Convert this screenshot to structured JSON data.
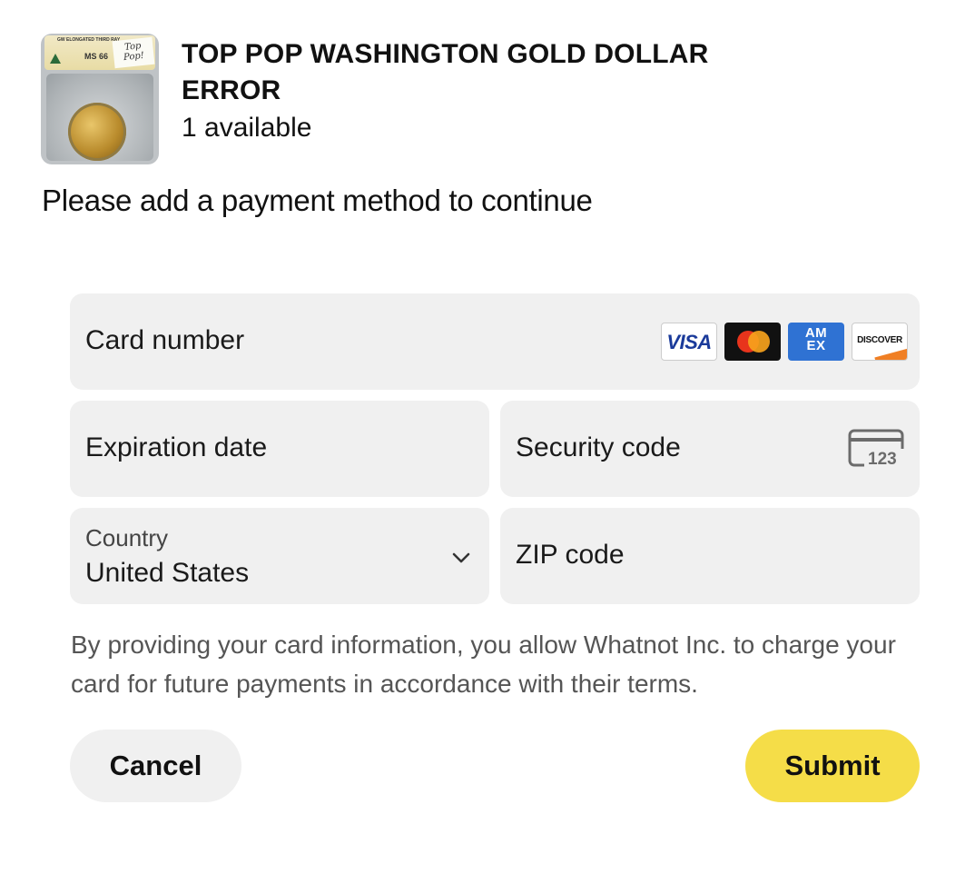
{
  "product": {
    "title": "TOP POP WASHINGTON GOLD DOLLAR ERROR",
    "availability": "1 available",
    "thumbnail": {
      "slab_description": "GW  ELONGATED THIRD RAY",
      "grade": "MS 66",
      "note": "Top Pop!"
    }
  },
  "prompt": "Please add a payment method to continue",
  "form": {
    "card_number_label": "Card number",
    "card_brands": [
      {
        "name": "visa-icon",
        "label": "VISA"
      },
      {
        "name": "mastercard-icon",
        "label": ""
      },
      {
        "name": "amex-icon",
        "label": "AM EX"
      },
      {
        "name": "discover-icon",
        "label": "DISCOVER"
      }
    ],
    "expiration_label": "Expiration date",
    "security_label": "Security code",
    "security_icon_text": "123",
    "country_label": "Country",
    "country_value": "United States",
    "zip_label": "ZIP code"
  },
  "consent": "By providing your card information, you allow Whatnot Inc. to charge your card for future payments in accordance with their terms.",
  "actions": {
    "cancel_label": "Cancel",
    "submit_label": "Submit"
  },
  "colors": {
    "field_bg": "#f0f0f0",
    "submit_bg": "#f5dd48",
    "text_primary": "#111111",
    "text_secondary": "#555555"
  }
}
